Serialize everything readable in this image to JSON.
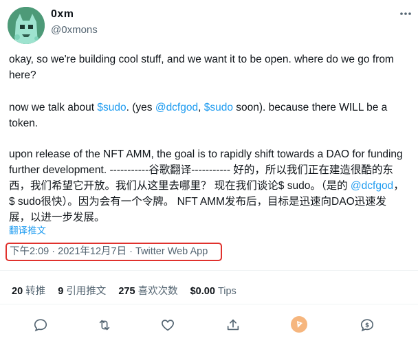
{
  "author": {
    "display_name": "0xm",
    "handle": "@0xmons"
  },
  "tweet": {
    "p1": "okay, so we're building cool stuff, and we want it to be open. where do we go from here?",
    "p2_a": "now we talk about ",
    "p2_link1": "$sudo",
    "p2_b": ". (yes ",
    "p2_link2": "@dcfgod",
    "p2_c": ", ",
    "p2_link3": "$sudo",
    "p2_d": " soon). because there WILL be a token.",
    "p3_a": "upon release of the NFT AMM, the goal is to rapidly shift towards a DAO for funding further development. -----------谷歌翻译----------- 好的，所以我们正在建造很酷的东西，我们希望它开放。我们从这里去哪里？ 现在我们谈论$ sudo。（是的 ",
    "p3_link": "@dcfgod",
    "p3_b": "，$ sudo很快）。因为会有一个令牌。 NFT AMM发布后，目标是迅速向DAO迅速发展，以进一步发展。",
    "translate": "翻译推文"
  },
  "meta": {
    "time": "下午2:09",
    "sep1": " · ",
    "date": "2021年12月7日",
    "sep2": " · ",
    "source": "Twitter Web App"
  },
  "stats": {
    "retweets_num": "20",
    "retweets_label": "转推",
    "quotes_num": "9",
    "quotes_label": "引用推文",
    "likes_num": "275",
    "likes_label": "喜欢次数",
    "tips_num": "$0.00",
    "tips_label": "Tips"
  },
  "actions": [
    "reply-icon",
    "retweet-icon",
    "like-icon",
    "share-icon",
    "tip-pizza-icon",
    "tip-dollar-icon"
  ],
  "colors": {
    "link": "#1d9bf0",
    "highlight_box": "#e0312d",
    "muted": "#536471",
    "avatar": "#4d9a78"
  }
}
